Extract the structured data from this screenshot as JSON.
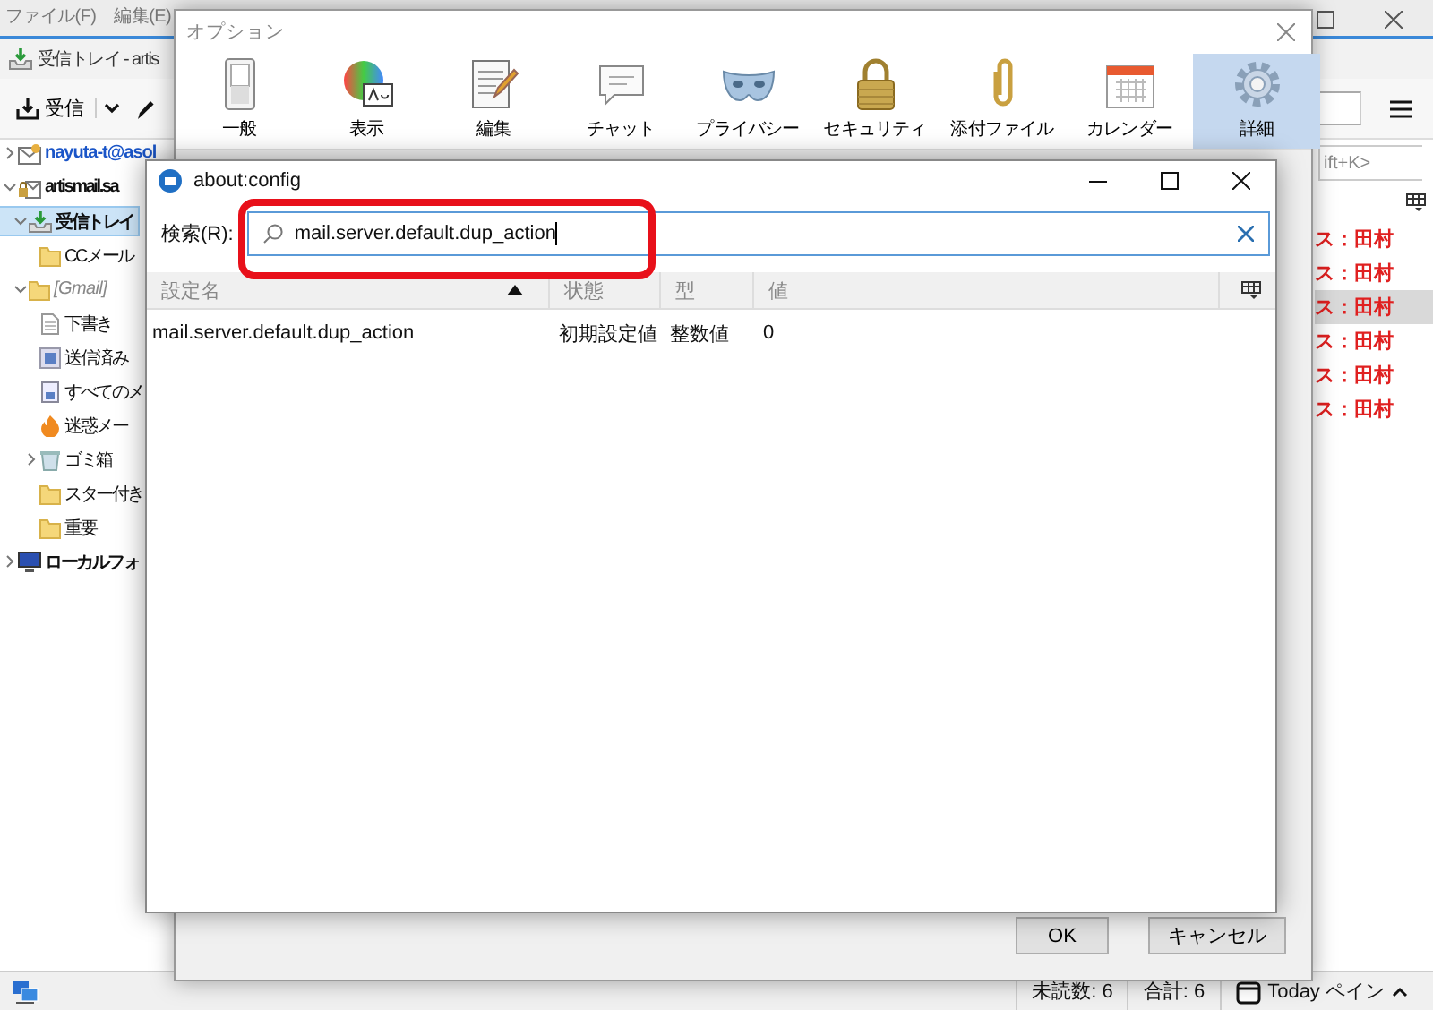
{
  "main_window": {
    "menu_bar": [
      "ファイル(F)",
      "編集(E)"
    ],
    "tab_title": "受信トレイ - artis",
    "toolbar": {
      "get_mail": "受信"
    },
    "quick_filter_hint": "ift+K>",
    "folders": [
      {
        "label": "nayuta-t@asol",
        "kind": "account",
        "expanded": false
      },
      {
        "label": "artismail.sa",
        "kind": "account2",
        "expanded": true,
        "children": [
          {
            "label": "受信トレイ",
            "kind": "inbox",
            "expanded": true,
            "selected": true,
            "children": [
              {
                "label": "CCメール",
                "kind": "folder"
              }
            ]
          },
          {
            "label": "[Gmail]",
            "kind": "group",
            "expanded": true,
            "children": [
              {
                "label": "下書き",
                "kind": "drafts"
              },
              {
                "label": "送信済み",
                "kind": "sent"
              },
              {
                "label": "すべてのメ",
                "kind": "archive"
              },
              {
                "label": "迷惑メー",
                "kind": "junk"
              },
              {
                "label": "ゴミ箱",
                "kind": "trash",
                "expanded": false
              },
              {
                "label": "スター付き",
                "kind": "folder"
              },
              {
                "label": "重要",
                "kind": "folder"
              }
            ]
          }
        ]
      },
      {
        "label": "ローカルフォ",
        "kind": "local",
        "expanded": false
      }
    ],
    "messages": [
      {
        "sender": "ス：田村",
        "selected": false
      },
      {
        "sender": "ス：田村",
        "selected": false
      },
      {
        "sender": "ス：田村",
        "selected": true
      },
      {
        "sender": "ス：田村",
        "selected": false
      },
      {
        "sender": "ス：田村",
        "selected": false
      },
      {
        "sender": "ス：田村",
        "selected": false
      }
    ],
    "status_bar": {
      "unread": "未読数: 6",
      "total": "合計: 6",
      "today_pane": "Today ペイン"
    }
  },
  "options_dialog": {
    "title": "オプション",
    "panes": [
      {
        "label": "一般",
        "kind": "general",
        "selected": false
      },
      {
        "label": "表示",
        "kind": "display",
        "selected": false
      },
      {
        "label": "編集",
        "kind": "compose",
        "selected": false
      },
      {
        "label": "チャット",
        "kind": "chat",
        "selected": false
      },
      {
        "label": "プライバシー",
        "kind": "privacy",
        "selected": false
      },
      {
        "label": "セキュリティ",
        "kind": "security",
        "selected": false
      },
      {
        "label": "添付ファイル",
        "kind": "attachments",
        "selected": false
      },
      {
        "label": "カレンダー",
        "kind": "calendar",
        "selected": false
      },
      {
        "label": "詳細",
        "kind": "advanced",
        "selected": true
      }
    ],
    "buttons": [
      "OK",
      "キャンセル"
    ]
  },
  "config_dialog": {
    "title": "about:config",
    "search": {
      "label": "検索(R):",
      "value": "mail.server.default.dup_action"
    },
    "columns": [
      {
        "label": "設定名",
        "sorted": true
      },
      {
        "label": "状態",
        "sorted": false
      },
      {
        "label": "型",
        "sorted": false
      },
      {
        "label": "値",
        "sorted": false
      }
    ],
    "rows": [
      {
        "cells": [
          "mail.server.default.dup_action",
          "初期設定値",
          "整数値",
          "0"
        ]
      }
    ]
  }
}
